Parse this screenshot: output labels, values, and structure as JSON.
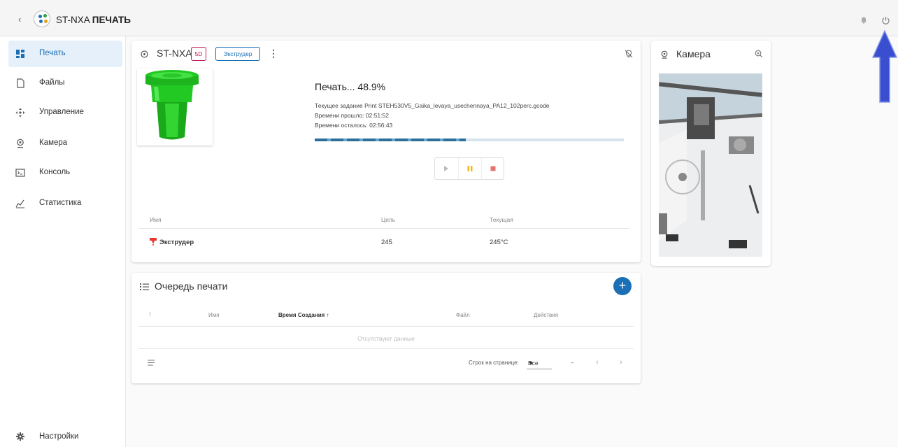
{
  "header": {
    "back_glyph": "‹",
    "title_prefix": "ST-NXA",
    "title_suffix": "ПЕЧАТЬ"
  },
  "sidebar": {
    "items": [
      {
        "label": "Печать",
        "icon": "dashboard-icon",
        "active": true
      },
      {
        "label": "Файлы",
        "icon": "file-icon"
      },
      {
        "label": "Управление",
        "icon": "move-icon"
      },
      {
        "label": "Камера",
        "icon": "webcam-icon"
      },
      {
        "label": "Консоль",
        "icon": "console-icon"
      },
      {
        "label": "Статистика",
        "icon": "chart-icon"
      }
    ],
    "settings_label": "Настройки"
  },
  "printer": {
    "name": "ST-NXA",
    "chip_5d": "5D",
    "chip_extruder": "Экструдер",
    "status": "Печать... 48.9%",
    "progress": 0.489,
    "job": "Текущее задание Print STEH530V5_Gaika_levaya_usechennaya_PA12_102perc.gcode",
    "elapsed": "Времени прошло: 02:51:52",
    "remaining": "Времени осталось: 02:56:43",
    "table": {
      "headers": {
        "name": "Имя",
        "target": "Цель",
        "current": "Текущая"
      },
      "rows": [
        {
          "name": "Экструдер",
          "target": "245",
          "current": "245°C"
        }
      ]
    }
  },
  "camera": {
    "title": "Камера"
  },
  "queue": {
    "title": "Очередь печати",
    "headers": {
      "sort": "↑",
      "name": "Имя",
      "created": "Время Создания ↑",
      "file": "Файл",
      "actions": "Действия"
    },
    "empty_text": "Отсутствуют данные",
    "rows_per_page_label": "Строк на странице:",
    "rows_per_page_value": "Все",
    "range_text": "–"
  },
  "colors": {
    "accent": "#1a6fb5",
    "print_color": "#22c922",
    "annotation_arrow": "#3a4fd0"
  }
}
